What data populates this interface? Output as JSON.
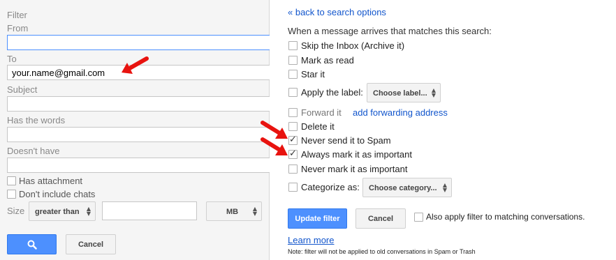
{
  "search_form": {
    "title": "Filter",
    "from_label": "From",
    "from_value": "",
    "to_label": "To",
    "to_value": "your.name@gmail.com",
    "subject_label": "Subject",
    "subject_value": "",
    "has_words_label": "Has the words",
    "has_words_value": "",
    "doesnt_have_label": "Doesn't have",
    "doesnt_have_value": "",
    "has_attachment_label": "Has attachment",
    "has_attachment_checked": false,
    "dont_include_chats_label": "Don't include chats",
    "dont_include_chats_checked": false,
    "size_label": "Size",
    "size_operator": "greater than",
    "size_value": "",
    "size_unit": "MB",
    "search_icon": "search-icon",
    "cancel_label": "Cancel"
  },
  "filter_actions": {
    "back_link": "« back to search options",
    "heading": "When a message arrives that matches this search:",
    "options": [
      {
        "label": "Skip the Inbox (Archive it)",
        "checked": false
      },
      {
        "label": "Mark as read",
        "checked": false
      },
      {
        "label": "Star it",
        "checked": false
      },
      {
        "label": "Apply the label:",
        "checked": false
      },
      {
        "label": "Forward it",
        "checked": false
      },
      {
        "label": "Delete it",
        "checked": false
      },
      {
        "label": "Never send it to Spam",
        "checked": true
      },
      {
        "label": "Always mark it as important",
        "checked": true
      },
      {
        "label": "Never mark it as important",
        "checked": false
      },
      {
        "label": "Categorize as:",
        "checked": false
      }
    ],
    "label_select": "Choose label...",
    "forwarding_link": "add forwarding address",
    "category_select": "Choose category...",
    "update_label": "Update filter",
    "cancel_label": "Cancel",
    "also_apply_label": "Also apply filter to matching conversations.",
    "also_apply_checked": false,
    "learn_more": "Learn more",
    "note": "Note: filter will not be applied to old conversations in Spam or Trash"
  },
  "annotations": {
    "arrow_color": "#e8130f"
  },
  "colors": {
    "accent": "#4d90fe",
    "link": "#1155cc"
  }
}
